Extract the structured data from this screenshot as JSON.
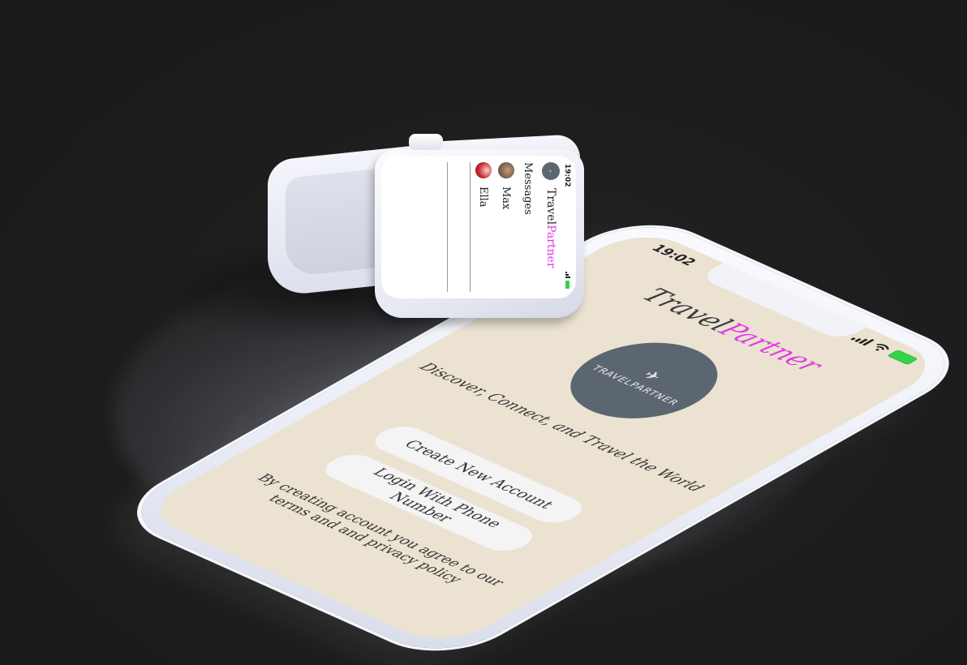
{
  "phone": {
    "status_time": "19:02",
    "title_part1": "Travel",
    "title_part2": "Partner",
    "logo_text": "TRAVELPARTNER",
    "tagline": "Discover, Connect, and Travel the World",
    "create_button": "Create New Account",
    "login_button": "Login With Phone Number",
    "terms_text": "By creating account you agree to our terms and and privacy policy",
    "accent_color": "#e23be3",
    "screen_color": "#ebe2d2",
    "battery_color": "#35d34b"
  },
  "watch": {
    "status_time": "19:02",
    "brand_part1": "Travel",
    "brand_part2": "Partner",
    "section_title": "Messages",
    "contacts": [
      {
        "name": "Max"
      },
      {
        "name": "Ella"
      }
    ]
  },
  "icons": [
    "signal-icon",
    "wifi-icon",
    "battery-icon",
    "plane-icon",
    "logo-circle"
  ]
}
